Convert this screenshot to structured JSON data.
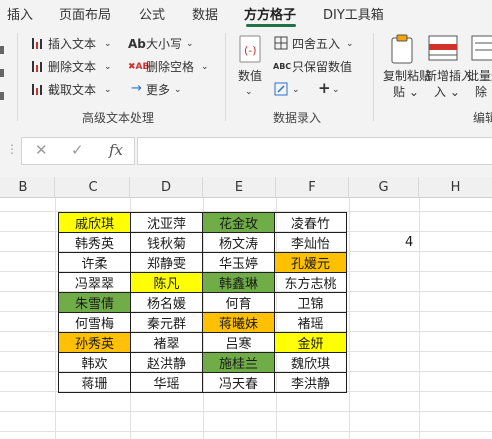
{
  "tabs": [
    "插入",
    "页面布局",
    "公式",
    "数据",
    "方方格子",
    "DIY工具箱"
  ],
  "active_tab": "方方格子",
  "ribbon": {
    "group1": {
      "items": [
        "插入文本",
        "删除文本",
        "截取文本",
        "大小写",
        "删除空格",
        "更多"
      ],
      "label": "高级文本处理"
    },
    "group2": {
      "value_label": "数值",
      "items": [
        "四舍五入",
        "只保留数值"
      ],
      "label": "数据录入"
    },
    "group3": {
      "copy_paste": "复制粘贴",
      "insert_new": "新增插入",
      "batch_delete": "批量删除",
      "label": "编辑"
    }
  },
  "formula_bar": {
    "cancel_icon": "✕",
    "confirm_icon": "✓",
    "fx_label": "fx",
    "value": ""
  },
  "columns": [
    "B",
    "C",
    "D",
    "E",
    "F",
    "G",
    "H"
  ],
  "cell_G": "4",
  "colors": {
    "yellow": "#ffff00",
    "green": "#70ad47",
    "orange": "#ffc000",
    "accent": "#217346"
  },
  "names": [
    [
      {
        "t": "戚欣琪",
        "c": "yellow"
      },
      {
        "t": "沈亚萍",
        "c": ""
      },
      {
        "t": "花金玫",
        "c": "green"
      },
      {
        "t": "凌春竹",
        "c": ""
      }
    ],
    [
      {
        "t": "韩秀英",
        "c": ""
      },
      {
        "t": "钱秋菊",
        "c": ""
      },
      {
        "t": "杨文涛",
        "c": ""
      },
      {
        "t": "李灿怡",
        "c": ""
      }
    ],
    [
      {
        "t": "许柔",
        "c": ""
      },
      {
        "t": "郑静雯",
        "c": ""
      },
      {
        "t": "华玉婷",
        "c": ""
      },
      {
        "t": "孔媛元",
        "c": "orange"
      }
    ],
    [
      {
        "t": "冯翠翠",
        "c": ""
      },
      {
        "t": "陈凡",
        "c": "yellow"
      },
      {
        "t": "韩鑫琳",
        "c": "green"
      },
      {
        "t": "东方志桃",
        "c": ""
      }
    ],
    [
      {
        "t": "朱雪倩",
        "c": "green"
      },
      {
        "t": "杨名媛",
        "c": ""
      },
      {
        "t": "何育",
        "c": ""
      },
      {
        "t": "卫锦",
        "c": ""
      }
    ],
    [
      {
        "t": "何雪梅",
        "c": ""
      },
      {
        "t": "秦元群",
        "c": ""
      },
      {
        "t": "蒋曦妹",
        "c": "orange"
      },
      {
        "t": "褚瑶",
        "c": ""
      }
    ],
    [
      {
        "t": "孙秀英",
        "c": "orange"
      },
      {
        "t": "褚翠",
        "c": ""
      },
      {
        "t": "吕寒",
        "c": ""
      },
      {
        "t": "金妍",
        "c": "yellow"
      }
    ],
    [
      {
        "t": "韩欢",
        "c": ""
      },
      {
        "t": "赵洪静",
        "c": ""
      },
      {
        "t": "施桂兰",
        "c": "green"
      },
      {
        "t": "魏欣琪",
        "c": ""
      }
    ],
    [
      {
        "t": "蒋珊",
        "c": ""
      },
      {
        "t": "华瑶",
        "c": ""
      },
      {
        "t": "冯天春",
        "c": ""
      },
      {
        "t": "李洪静",
        "c": ""
      }
    ]
  ]
}
